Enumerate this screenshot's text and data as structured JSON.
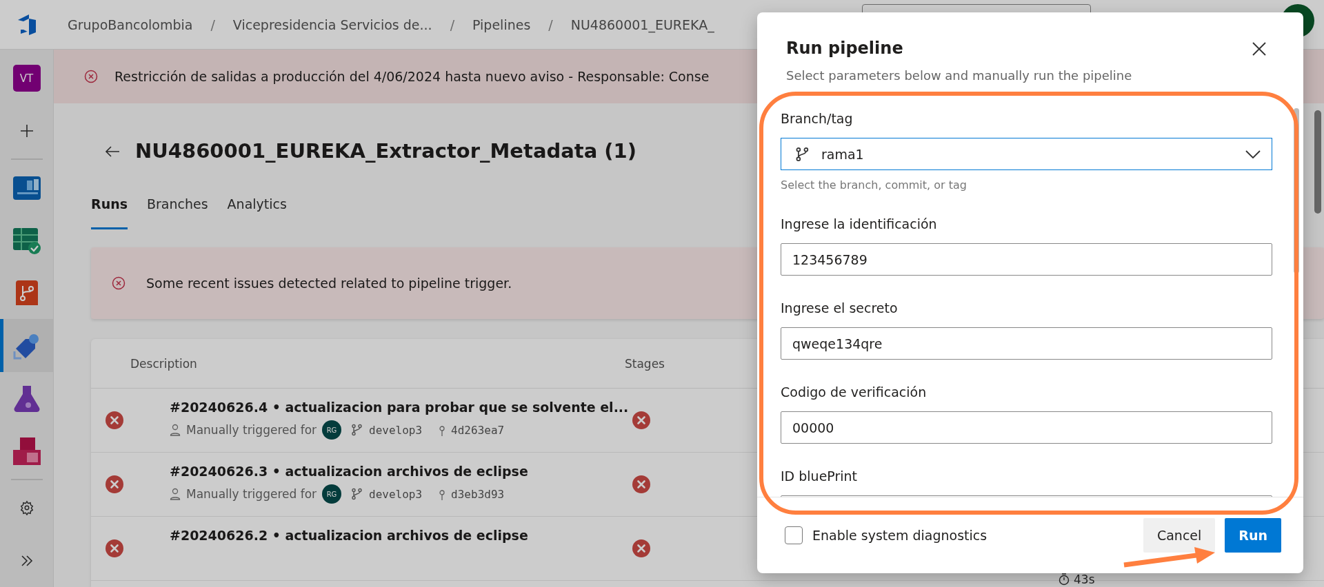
{
  "top_bar": {
    "separator": "/",
    "breadcrumbs": [
      "GrupoBancolombia",
      "Vicepresidencia Servicios de...",
      "Pipelines",
      "NU4860001_EUREKA_"
    ]
  },
  "rail": {
    "avatar": "VT",
    "items": [
      {
        "kind": "add",
        "selected": false
      },
      {
        "kind": "boards",
        "selected": false
      },
      {
        "kind": "plans",
        "selected": false
      },
      {
        "kind": "repos",
        "selected": false
      },
      {
        "kind": "pipelines",
        "selected": true
      },
      {
        "kind": "tests",
        "selected": false
      },
      {
        "kind": "artifacts",
        "selected": false
      },
      {
        "kind": "settings",
        "selected": false
      },
      {
        "kind": "expand",
        "selected": false
      }
    ]
  },
  "banner": {
    "text": "Restricción de salidas a producción del 4/06/2024 hasta nuevo aviso - Responsable: Conse"
  },
  "page": {
    "title": "NU4860001_EUREKA_Extractor_Metadata (1)",
    "tabs": [
      {
        "label": "Runs",
        "selected": true
      },
      {
        "label": "Branches",
        "selected": false
      },
      {
        "label": "Analytics",
        "selected": false
      }
    ],
    "alert": "Some recent issues detected related to pipeline trigger.",
    "table": {
      "columns": [
        "Description",
        "Stages"
      ],
      "rows": [
        {
          "failed": true,
          "title": "#20240626.4 • actualizacion para probar que se solvente el...",
          "trigger": "Manually triggered for",
          "avatar": "RG",
          "branch": "develop3",
          "commit": "4d263ea7",
          "stage_failed": true
        },
        {
          "failed": true,
          "title": "#20240626.3 • actualizacion archivos de eclipse",
          "trigger": "Manually triggered for",
          "avatar": "RG",
          "branch": "develop3",
          "commit": "d3eb3d93",
          "stage_failed": true
        },
        {
          "failed": true,
          "title": "#20240626.2 • actualizacion archivos de eclipse",
          "stage_failed": true,
          "duration": "43s"
        }
      ]
    }
  },
  "dialog": {
    "title": "Run pipeline",
    "subtitle": "Select parameters below and manually run the pipeline",
    "fields": [
      {
        "kind": "select",
        "label": "Branch/tag",
        "value": "rama1",
        "help": "Select the branch, commit, or tag"
      },
      {
        "kind": "text",
        "label": "Ingrese la identificación",
        "value": "123456789"
      },
      {
        "kind": "text",
        "label": "Ingrese el secreto",
        "value": "qweqe134qre"
      },
      {
        "kind": "text",
        "label": "Codigo de verificación",
        "value": "00000"
      },
      {
        "kind": "text",
        "label": "ID bluePrint"
      }
    ],
    "diagnostics": {
      "label": "Enable system diagnostics",
      "checked": false
    },
    "buttons": [
      {
        "kind": "secondary",
        "label": "Cancel"
      },
      {
        "kind": "primary",
        "label": "Run"
      }
    ]
  }
}
